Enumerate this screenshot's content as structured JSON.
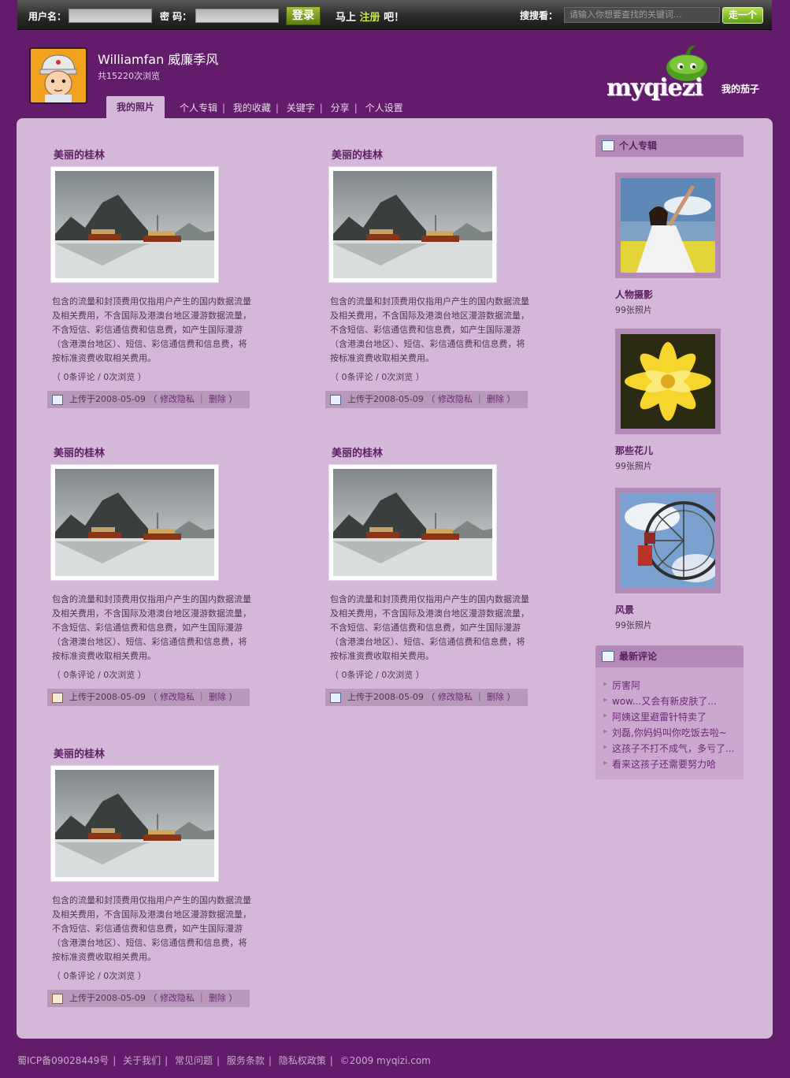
{
  "topbar": {
    "username_label": "用户名：",
    "password_label": "密  码：",
    "login_button": "登录",
    "register_prefix": "马上",
    "register_link": "注册",
    "register_suffix": "吧！",
    "search_label": "搜搜看：",
    "search_placeholder": "请输入你想要查找的关键词...",
    "search_button": "走一个"
  },
  "profile": {
    "name": "Williamfan 威廉季风",
    "visits": "共15220次浏览"
  },
  "logo": {
    "text": "myqiezi",
    "sub": "我的茄子"
  },
  "nav": {
    "active": "我的照片",
    "items": [
      "个人专辑",
      "我的收藏",
      "关键字",
      "分享",
      "个人设置"
    ]
  },
  "photos": [
    {
      "title": "美丽的桂林",
      "desc": "包含的流量和封顶费用仅指用户产生的国内数据流量及相关费用，不含国际及港澳台地区漫游数据流量，不含短信、彩信通信费和信息费，如产生国际漫游（含港澳台地区）、短信、彩信通信费和信息费，将按标准资费收取相关费用。",
      "stats": "（ 0条评论  /  0次浏览  ）",
      "uploaded": "上传于2008-05-09",
      "edit_privacy": "修改隐私",
      "delete": "删除"
    },
    {
      "title": "美丽的桂林",
      "desc": "包含的流量和封顶费用仅指用户产生的国内数据流量及相关费用，不含国际及港澳台地区漫游数据流量，不含短信、彩信通信费和信息费，如产生国际漫游（含港澳台地区）、短信、彩信通信费和信息费，将按标准资费收取相关费用。",
      "stats": "（ 0条评论  /  0次浏览  ）",
      "uploaded": "上传于2008-05-09",
      "edit_privacy": "修改隐私",
      "delete": "删除"
    },
    {
      "title": "美丽的桂林",
      "desc": "包含的流量和封顶费用仅指用户产生的国内数据流量及相关费用，不含国际及港澳台地区漫游数据流量，不含短信、彩信通信费和信息费，如产生国际漫游（含港澳台地区）、短信、彩信通信费和信息费，将按标准资费收取相关费用。",
      "stats": "（ 0条评论  /  0次浏览  ）",
      "uploaded": "上传于2008-05-09",
      "edit_privacy": "修改隐私",
      "delete": "删除"
    },
    {
      "title": "美丽的桂林",
      "desc": "包含的流量和封顶费用仅指用户产生的国内数据流量及相关费用，不含国际及港澳台地区漫游数据流量，不含短信、彩信通信费和信息费，如产生国际漫游（含港澳台地区）、短信、彩信通信费和信息费，将按标准资费收取相关费用。",
      "stats": "（ 0条评论  /  0次浏览  ）",
      "uploaded": "上传于2008-05-09",
      "edit_privacy": "修改隐私",
      "delete": "删除"
    },
    {
      "title": "美丽的桂林",
      "desc": "包含的流量和封顶费用仅指用户产生的国内数据流量及相关费用，不含国际及港澳台地区漫游数据流量，不含短信、彩信通信费和信息费，如产生国际漫游（含港澳台地区）、短信、彩信通信费和信息费，将按标准资费收取相关费用。",
      "stats": "（ 0条评论  /  0次浏览  ）",
      "uploaded": "上传于2008-05-09",
      "edit_privacy": "修改隐私",
      "delete": "删除"
    }
  ],
  "sidebar": {
    "albums_title": "个人专辑",
    "albums": [
      {
        "name": "人物摄影",
        "count": "99张照片"
      },
      {
        "name": "那些花儿",
        "count": "99张照片"
      },
      {
        "name": "风景",
        "count": "99张照片"
      }
    ],
    "comments_title": "最新评论",
    "comments": [
      "厉害阿",
      "wow...又会有新皮肤了...",
      "阿姨这里避雷针特卖了",
      "刘磊,你妈妈叫你吃饭去啦~",
      "这孩子不打不成气，多亏了...",
      "看来这孩子还需要努力哈"
    ]
  },
  "footer": {
    "icp": "蜀ICP备09028449号",
    "links": [
      "关于我们",
      "常见问题",
      "服务条款",
      "隐私权政策"
    ],
    "copyright": "©2009 myqizi.com"
  }
}
